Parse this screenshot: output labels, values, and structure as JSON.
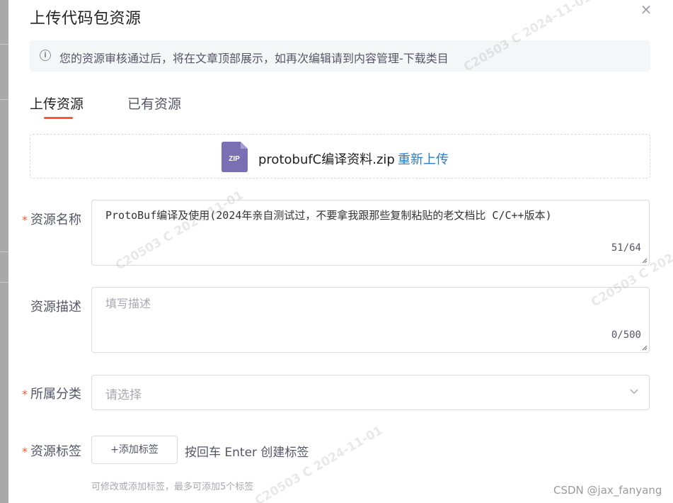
{
  "dialog": {
    "title": "上传代码包资源",
    "close_symbol": "×"
  },
  "notice": {
    "icon": "info-icon",
    "text": "您的资源审核通过后，将在文章顶部展示，如再次编辑请到内容管理-下载类目"
  },
  "tabs": [
    {
      "label": "上传资源",
      "active": true
    },
    {
      "label": "已有资源",
      "active": false
    }
  ],
  "file": {
    "icon_label": "ZIP",
    "name": "protobufC编译资料.zip",
    "reupload_label": "重新上传"
  },
  "form": {
    "name": {
      "label": "资源名称",
      "required": "*",
      "value": "ProtoBuf编译及使用(2024年亲自测试过，不要拿我跟那些复制粘贴的老文档比  C/C++版本)",
      "count": "51/64"
    },
    "description": {
      "label": "资源描述",
      "placeholder": "填写描述",
      "count": "0/500"
    },
    "category": {
      "label": "所属分类",
      "required": "*",
      "placeholder": "请选择"
    },
    "tags": {
      "label": "资源标签",
      "required": "*",
      "add_button": "+添加标签",
      "hint": "按回车 Enter 创建标签",
      "help": "可修改或添加标签，最多可添加5个标签"
    }
  },
  "watermarks": [
    "C20503 C 2024-11-01"
  ],
  "footer_mark": "CSDN @jax_fanyang",
  "colors": {
    "accent": "#fc5531",
    "link": "#2a7bc9",
    "zip_icon": "#7b6fb3"
  }
}
